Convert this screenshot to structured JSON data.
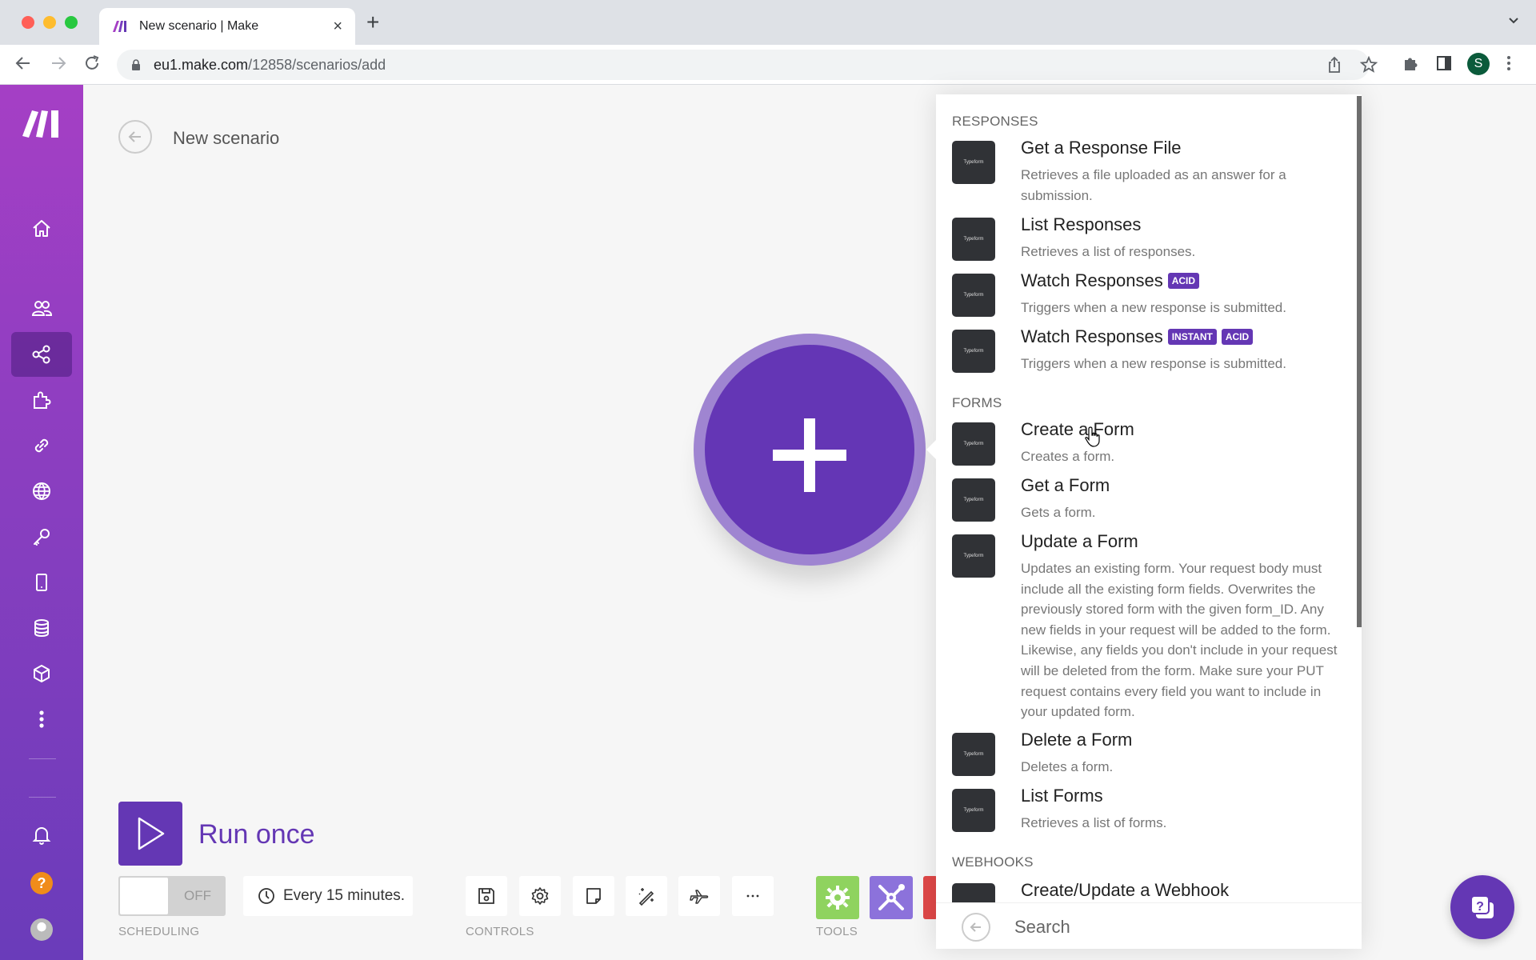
{
  "browser": {
    "tab_title": "New scenario | Make",
    "url_host": "eu1.make.com",
    "url_path": "/12858/scenarios/add",
    "profile_initial": "S"
  },
  "sidebar": {
    "items": [
      {
        "icon": "home-icon"
      },
      {
        "icon": "team-icon"
      },
      {
        "icon": "scenarios-icon",
        "active": true
      },
      {
        "icon": "templates-icon"
      },
      {
        "icon": "connections-icon"
      },
      {
        "icon": "webhooks-icon"
      },
      {
        "icon": "keys-icon"
      },
      {
        "icon": "devices-icon"
      },
      {
        "icon": "datastores-icon"
      },
      {
        "icon": "datastructures-icon"
      },
      {
        "icon": "more-icon"
      }
    ],
    "help_label": "?"
  },
  "header": {
    "title": "New scenario"
  },
  "toolbar": {
    "run_once_label": "Run once",
    "scheduling_toggle": "OFF",
    "schedule_text": "Every 15 minutes.",
    "scheduling_label": "SCHEDULING",
    "controls_label": "CONTROLS",
    "tools_label": "TOOLS",
    "controls": [
      "save",
      "settings",
      "notes",
      "auto-align",
      "explain-flow",
      "more"
    ],
    "tool_colors": {
      "flow": "#8fd35f",
      "tools": "#8c72db",
      "text": "#e04848"
    }
  },
  "panel": {
    "sections": [
      {
        "title": "RESPONSES",
        "modules": [
          {
            "name": "Get a Response File",
            "desc": "Retrieves a file uploaded as an answer for a submission.",
            "badges": []
          },
          {
            "name": "List Responses",
            "desc": "Retrieves a list of responses.",
            "badges": []
          },
          {
            "name": "Watch Responses",
            "desc": "Triggers when a new response is submitted.",
            "badges": [
              "ACID"
            ]
          },
          {
            "name": "Watch Responses",
            "desc": "Triggers when a new response is submitted.",
            "badges": [
              "INSTANT",
              "ACID"
            ]
          }
        ]
      },
      {
        "title": "FORMS",
        "modules": [
          {
            "name": "Create a Form",
            "desc": "Creates a form.",
            "badges": []
          },
          {
            "name": "Get a Form",
            "desc": "Gets a form.",
            "badges": []
          },
          {
            "name": "Update a Form",
            "desc": "Updates an existing form. Your request body must include all the existing form fields. Overwrites the previously stored form with the given form_ID. Any new fields in your request will be added to the form. Likewise, any fields you don't include in your request will be deleted from the form. Make sure your PUT request contains every field you want to include in your updated form.",
            "badges": []
          },
          {
            "name": "Delete a Form",
            "desc": "Deletes a form.",
            "badges": []
          },
          {
            "name": "List Forms",
            "desc": "Retrieves a list of forms.",
            "badges": []
          }
        ]
      },
      {
        "title": "WEBHOOKS",
        "modules": [
          {
            "name": "Create/Update a Webhook",
            "desc": "",
            "badges": []
          }
        ]
      }
    ],
    "app_icon_label": "Typeform",
    "search_placeholder": "Search"
  },
  "colors": {
    "brand": "#6437b4",
    "badge": "#6437b4"
  }
}
